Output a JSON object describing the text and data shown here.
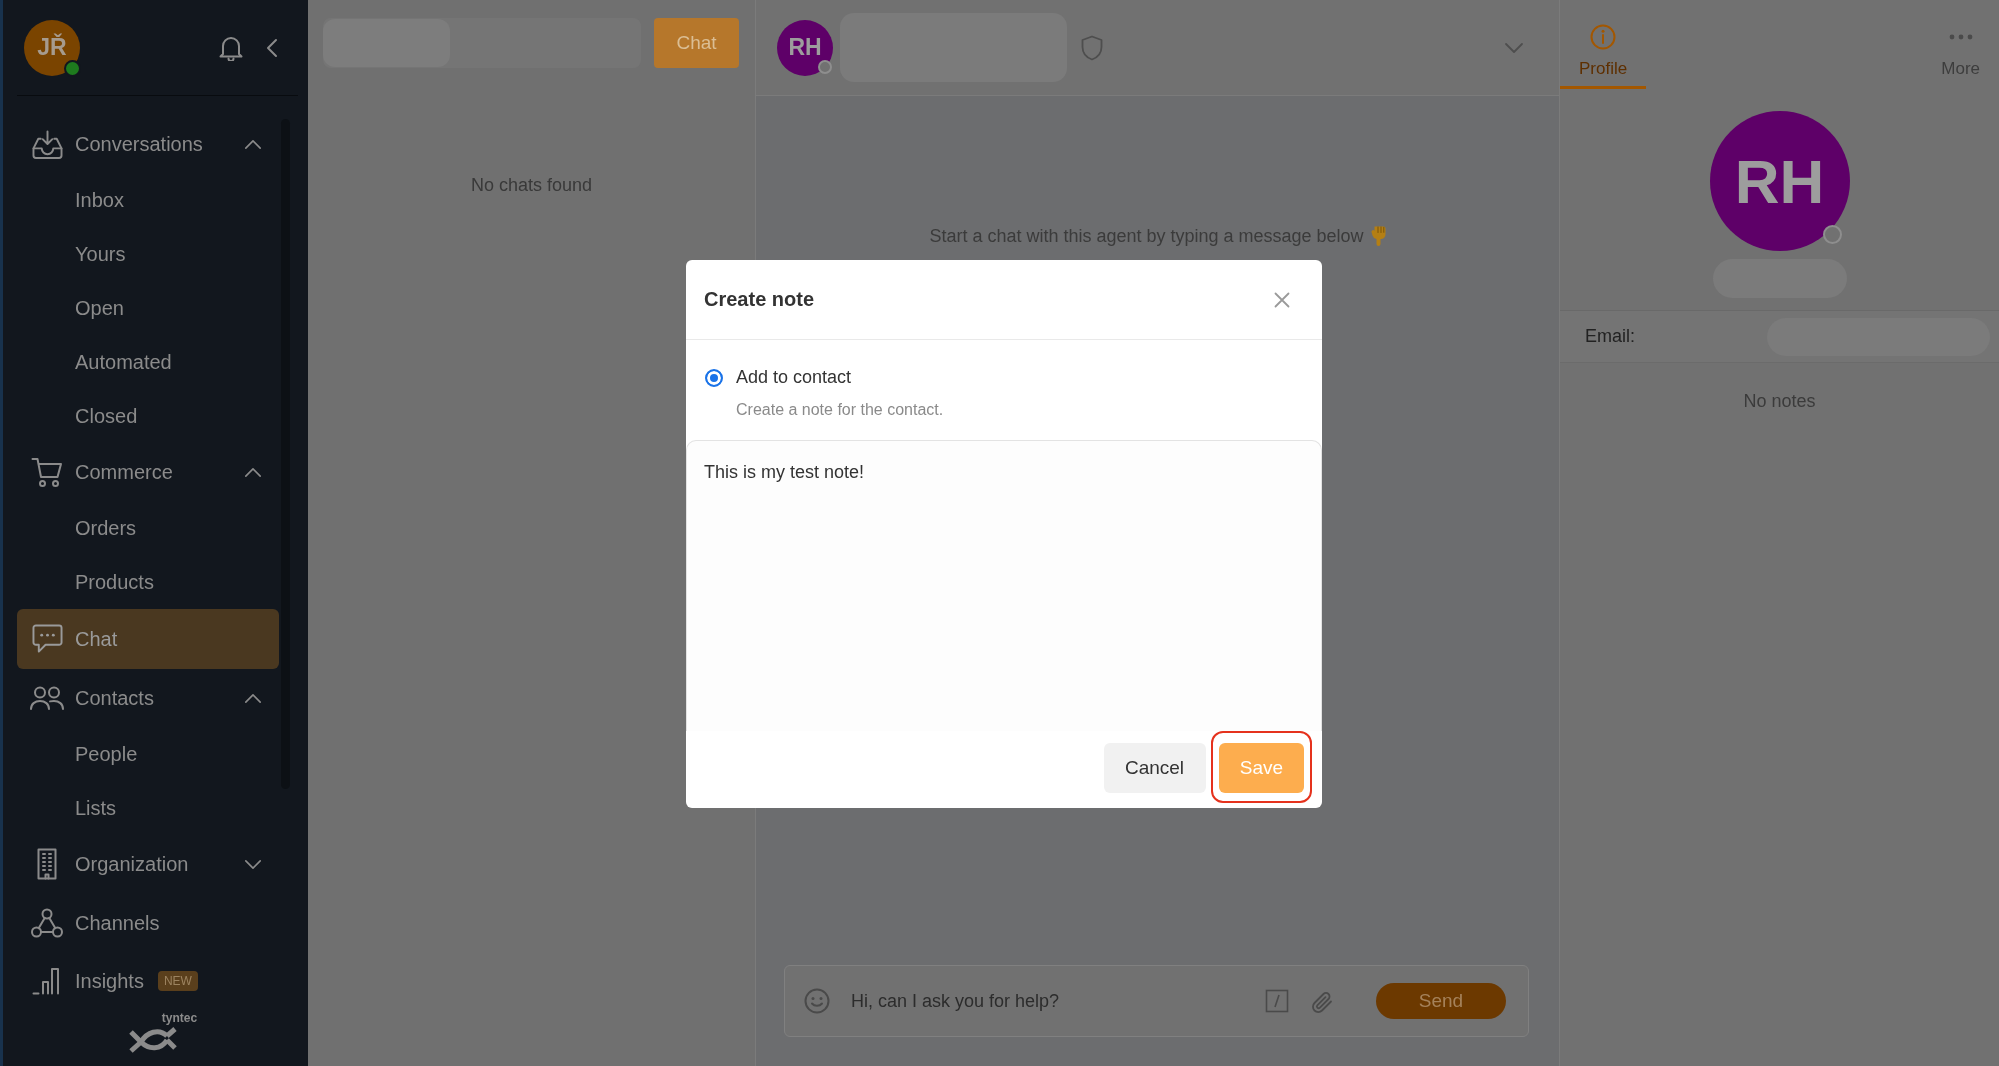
{
  "sidebar": {
    "user": {
      "initials": "JŘ",
      "online": true
    },
    "nav": [
      {
        "kind": "group",
        "label": "Conversations",
        "expanded": true,
        "selected": false,
        "children": [
          {
            "label": "Inbox",
            "selected": false
          },
          {
            "label": "Yours",
            "selected": false
          },
          {
            "label": "Open",
            "selected": false
          },
          {
            "label": "Automated",
            "selected": false
          },
          {
            "label": "Closed",
            "selected": false
          }
        ]
      },
      {
        "kind": "group",
        "label": "Commerce",
        "expanded": true,
        "selected": false,
        "children": [
          {
            "label": "Orders",
            "selected": false
          },
          {
            "label": "Products",
            "selected": false
          }
        ]
      },
      {
        "kind": "link",
        "label": "Chat",
        "selected": true
      },
      {
        "kind": "group",
        "label": "Contacts",
        "expanded": true,
        "selected": false,
        "children": [
          {
            "label": "People",
            "selected": false
          },
          {
            "label": "Lists",
            "selected": false
          }
        ]
      },
      {
        "kind": "group",
        "label": "Organization",
        "expanded": false,
        "selected": false
      },
      {
        "kind": "link",
        "label": "Channels",
        "selected": false
      },
      {
        "kind": "link",
        "label": "Insights",
        "selected": false,
        "badge": "NEW"
      }
    ],
    "logo": {
      "text": "tyntec"
    }
  },
  "chat_list": {
    "new_chat_button": "Chat",
    "empty_message": "No chats found"
  },
  "chat": {
    "contact": {
      "initials": "RH",
      "online": false
    },
    "empty_hint": "Start a chat with this agent by typing a message below",
    "composer": {
      "placeholder": "Hi, can I ask you for help?",
      "send_button": "Send"
    }
  },
  "details_panel": {
    "tabs": [
      {
        "label": "Profile",
        "selected": true
      },
      {
        "label": "More",
        "selected": false
      }
    ],
    "contact": {
      "initials": "RH",
      "online": false
    },
    "fields": [
      {
        "label": "Email:"
      }
    ],
    "empty_notes": "No notes"
  },
  "modal": {
    "title": "Create note",
    "options": [
      {
        "label": "Add to contact",
        "description": "Create a note for the contact.",
        "selected": true
      }
    ],
    "note": {
      "value": "This is my test note!"
    },
    "buttons": [
      {
        "label": "Cancel",
        "kind": "secondary",
        "highlighted": false
      },
      {
        "label": "Save",
        "kind": "primary",
        "highlighted": true
      }
    ]
  }
}
